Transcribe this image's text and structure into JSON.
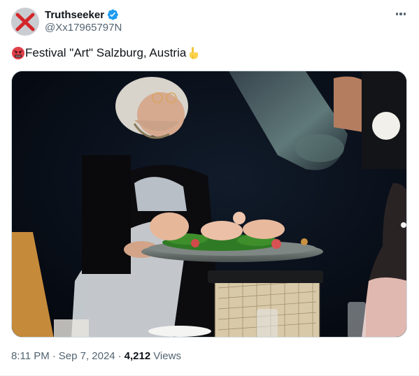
{
  "author": {
    "display_name": "Truthseeker",
    "handle": "@Xx17965797N",
    "avatar_icon": "red-x-avatar",
    "verified_icon": "verified-badge-icon",
    "verified_color": "#1d9bf0"
  },
  "tweet": {
    "text": "Festival \"Art\" Salzburg, Austria",
    "leading_emoji": "angry-face-emoji",
    "trailing_emoji": "pointing-down-emoji"
  },
  "menu": {
    "icon": "more-options-icon"
  },
  "meta": {
    "time": "8:11 PM",
    "date": "Sep 7, 2024",
    "separator": "·",
    "views_count": "4,212",
    "views_label": "Views"
  },
  "colors": {
    "text_primary": "#0f1419",
    "text_secondary": "#536471",
    "border": "#cfd9de"
  }
}
